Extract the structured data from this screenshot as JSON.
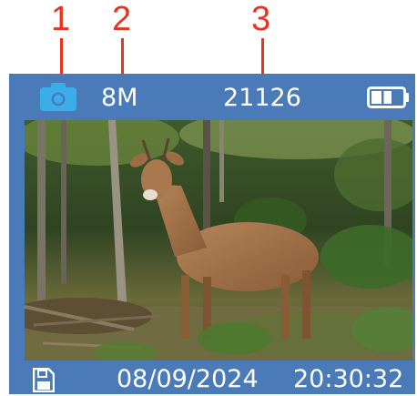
{
  "callouts": [
    "1",
    "2",
    "3"
  ],
  "status_bar": {
    "mode_icon": "camera-icon",
    "resolution": "8M",
    "shot_count": "21126",
    "battery_icon": "battery-icon",
    "battery_level": 0.66
  },
  "preview": {
    "subject": "photo-preview"
  },
  "footer": {
    "storage_icon": "sd-card-icon",
    "date": "08/09/2024",
    "time": "20:30:32"
  },
  "colors": {
    "callout": "#e8331e",
    "frame": "#4a7ab8",
    "camera_icon": "#3aaee8",
    "text": "#ffffff"
  }
}
